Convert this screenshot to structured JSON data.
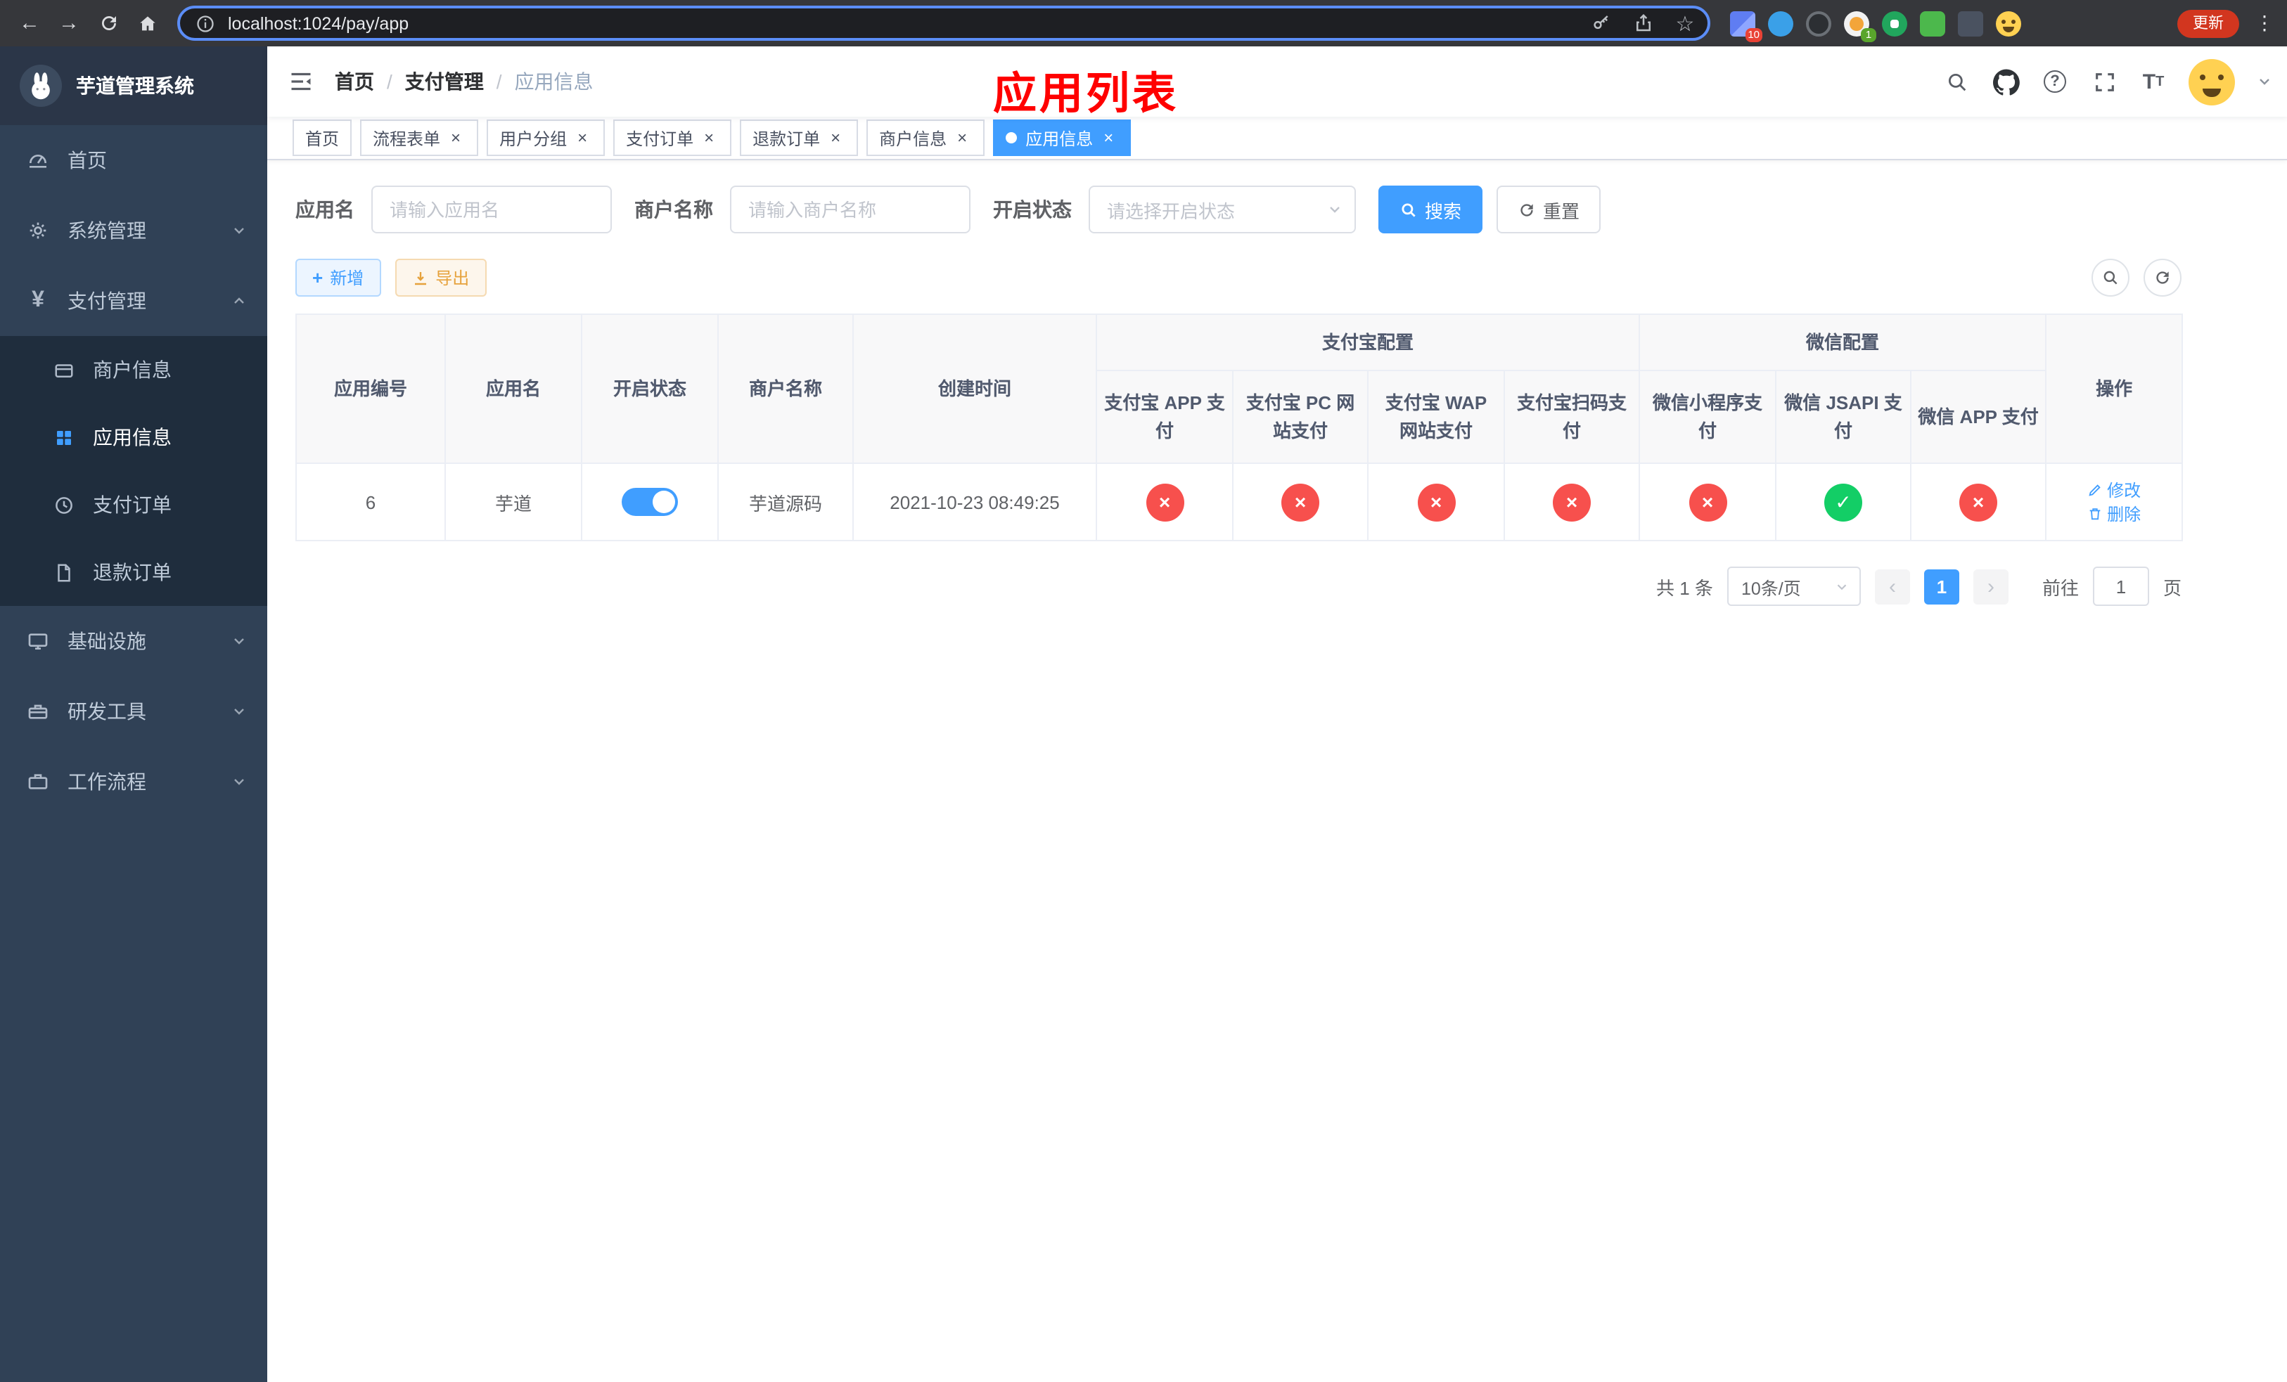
{
  "browser": {
    "url": "localhost:1024/pay/app",
    "update_label": "更新",
    "ext_badge_first": "10",
    "ext_badge_second": "1"
  },
  "sidebar": {
    "title": "芋道管理系统",
    "items": {
      "home": "首页",
      "system": "系统管理",
      "payment": "支付管理",
      "merchant_info": "商户信息",
      "app_info": "应用信息",
      "pay_order": "支付订单",
      "refund_order": "退款订单",
      "infra": "基础设施",
      "dev_tools": "研发工具",
      "workflow": "工作流程"
    }
  },
  "navbar": {
    "breadcrumb": {
      "home": "首页",
      "payment": "支付管理",
      "current": "应用信息"
    },
    "overlay_title": "应用列表"
  },
  "tabs": [
    {
      "label": "首页"
    },
    {
      "label": "流程表单"
    },
    {
      "label": "用户分组"
    },
    {
      "label": "支付订单"
    },
    {
      "label": "退款订单"
    },
    {
      "label": "商户信息"
    },
    {
      "label": "应用信息"
    }
  ],
  "filters": {
    "app_name_label": "应用名",
    "app_name_placeholder": "请输入应用名",
    "merchant_label": "商户名称",
    "merchant_placeholder": "请输入商户名称",
    "status_label": "开启状态",
    "status_placeholder": "请选择开启状态",
    "search_label": "搜索",
    "reset_label": "重置"
  },
  "toolbar": {
    "add_label": "新增",
    "export_label": "导出"
  },
  "table": {
    "columns": {
      "app_id": "应用编号",
      "app_name": "应用名",
      "status": "开启状态",
      "merchant": "商户名称",
      "created": "创建时间",
      "alipay_group": "支付宝配置",
      "wechat_group": "微信配置",
      "alipay_app": "支付宝 APP 支付",
      "alipay_pc": "支付宝 PC 网站支付",
      "alipay_wap": "支付宝 WAP 网站支付",
      "alipay_qr": "支付宝扫码支付",
      "wx_mini": "微信小程序支付",
      "wx_jsapi": "微信 JSAPI 支付",
      "wx_app": "微信 APP 支付",
      "actions": "操作"
    },
    "row": {
      "id": "6",
      "name": "芋道",
      "enabled": true,
      "merchant": "芋道源码",
      "created": "2021-10-23 08:49:25",
      "pay_statuses": [
        false,
        false,
        false,
        false,
        false,
        true,
        false
      ],
      "edit_label": "修改",
      "delete_label": "删除"
    }
  },
  "pagination": {
    "total": "共 1 条",
    "page_size": "10条/页",
    "page": "1",
    "goto": "前往",
    "goto_value": "1",
    "unit": "页"
  },
  "glyphs": {
    "check": "✓",
    "cross": "×",
    "star": "☆",
    "kebab": "⋮",
    "back": "←",
    "forward": "→",
    "prev": "‹",
    "next": "›",
    "plus": "+",
    "yen": "¥"
  },
  "colors": {
    "primary": "#409eff",
    "success": "#13ce66",
    "danger": "#f7504d",
    "warning": "#e6a23c",
    "sidebar_bg": "#304156",
    "submenu_bg": "#1f2d3d",
    "title_red": "#ff0000"
  }
}
